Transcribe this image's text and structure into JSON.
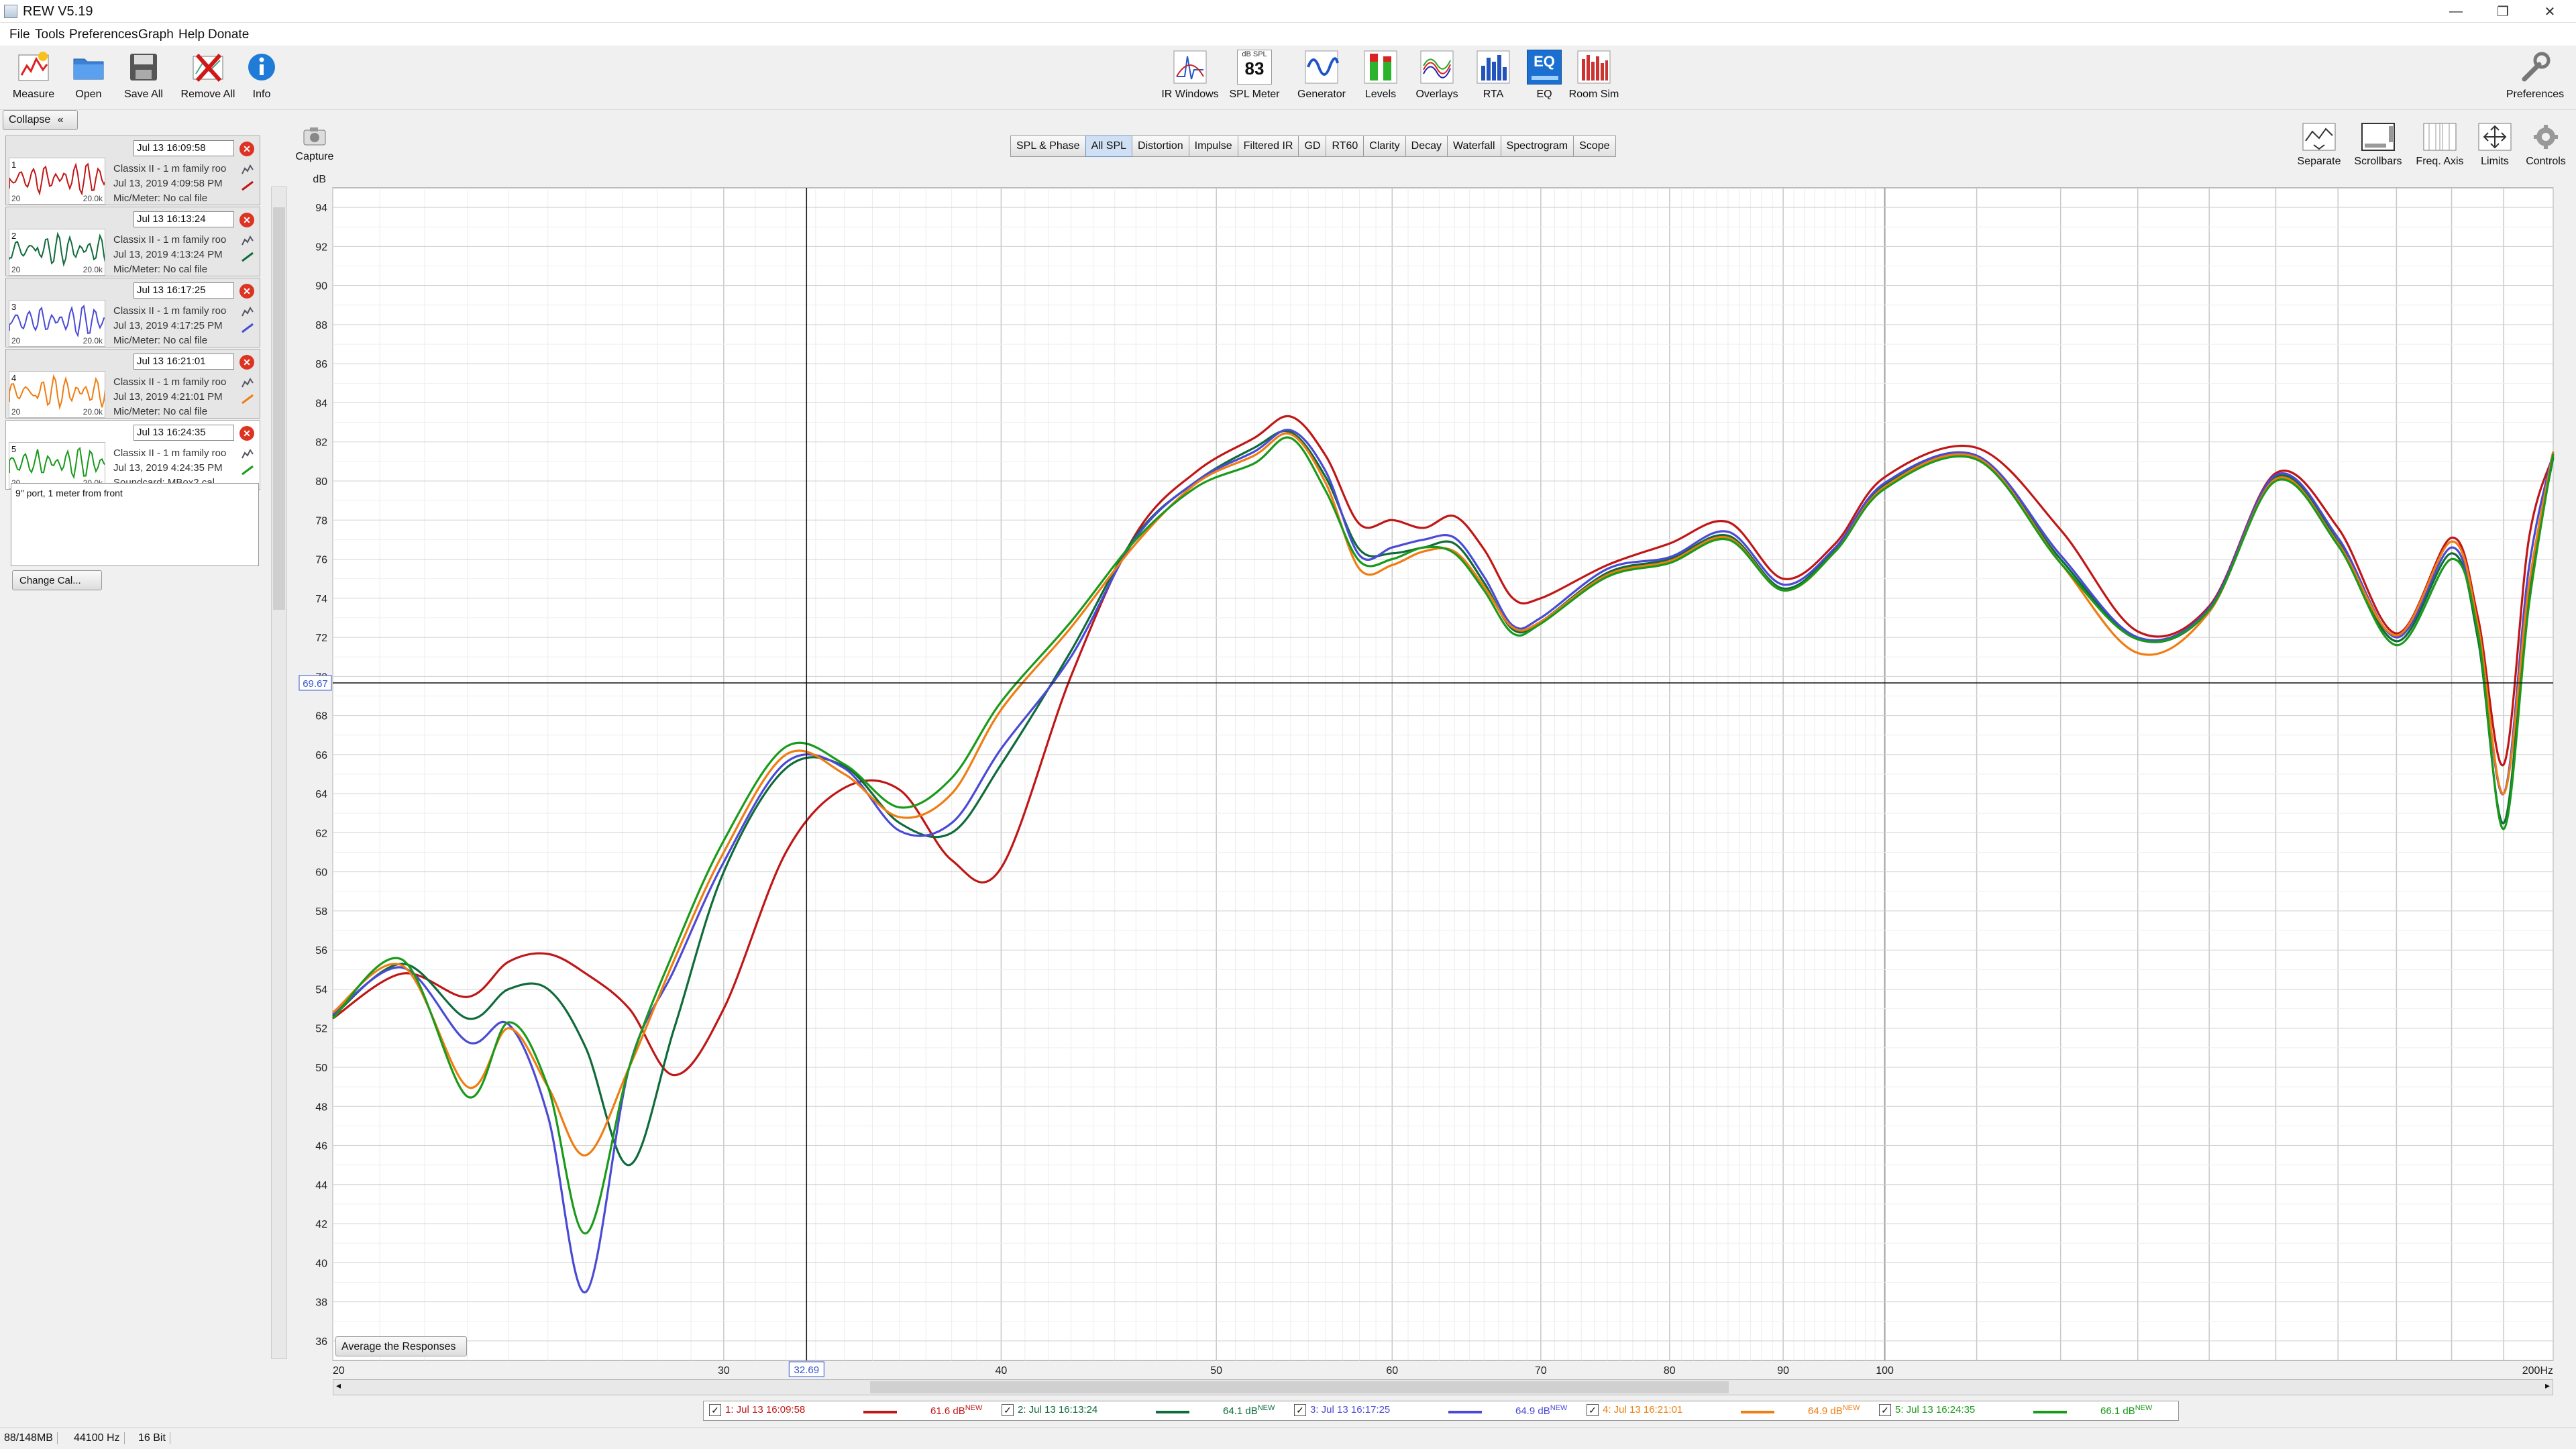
{
  "window": {
    "title": "REW V5.19",
    "controls": [
      "—",
      "❐",
      "✕"
    ]
  },
  "menu": [
    "File",
    "Tools",
    "Preferences",
    "Graph",
    "Help",
    "Donate"
  ],
  "toolbar_left": [
    "Measure",
    "Open",
    "Save All",
    "Remove All",
    "Info"
  ],
  "toolbar_center": [
    "IR Windows",
    "SPL Meter",
    "Generator",
    "Levels",
    "Overlays",
    "RTA",
    "EQ",
    "Room Sim"
  ],
  "spl_meter_value": "83",
  "spl_meter_unit": "dB SPL",
  "eq_icon_text": "EQ",
  "toolbar_right": "Preferences",
  "left_panel": {
    "collapse_label": "Collapse",
    "measurements": [
      {
        "num": "1",
        "name": "Jul 13 16:09:58",
        "desc": "Classix II - 1 m family roo",
        "date": "Jul 13, 2019 4:09:58 PM",
        "cal": "Mic/Meter: No cal file",
        "color": "#c01616",
        "selected": false
      },
      {
        "num": "2",
        "name": "Jul 13 16:13:24",
        "desc": "Classix II - 1 m family roo",
        "date": "Jul 13, 2019 4:13:24 PM",
        "cal": "Mic/Meter: No cal file",
        "color": "#0f6b3a",
        "selected": false
      },
      {
        "num": "3",
        "name": "Jul 13 16:17:25",
        "desc": "Classix II - 1 m family roo",
        "date": "Jul 13, 2019 4:17:25 PM",
        "cal": "Mic/Meter: No cal file",
        "color": "#4a4ad6",
        "selected": false
      },
      {
        "num": "4",
        "name": "Jul 13 16:21:01",
        "desc": "Classix II - 1 m family roo",
        "date": "Jul 13, 2019 4:21:01 PM",
        "cal": "Mic/Meter: No cal file",
        "color": "#ef7d12",
        "selected": false
      },
      {
        "num": "5",
        "name": "Jul 13 16:24:35",
        "desc": "Classix II - 1 m family roo",
        "date": "Jul 13, 2019 4:24:35 PM",
        "cal": "Soundcard: MBox2.cal",
        "color": "#1a9a1a",
        "selected": true
      }
    ],
    "thumb_low": "20",
    "thumb_high": "20.0k",
    "notes": "9\" port, 1 meter from front",
    "change_cal_label": "Change Cal..."
  },
  "capture_label": "Capture",
  "tabs": [
    "SPL & Phase",
    "All SPL",
    "Distortion",
    "Impulse",
    "Filtered IR",
    "GD",
    "RT60",
    "Clarity",
    "Decay",
    "Waterfall",
    "Spectrogram",
    "Scope"
  ],
  "active_tab": "All SPL",
  "graph_tools": [
    "Separate",
    "Scrollbars",
    "Freq. Axis",
    "Limits",
    "Controls"
  ],
  "average_button": "Average the Responses",
  "legend": [
    {
      "label": "1: Jul 13 16:09:58",
      "db": "61.6 dB",
      "color": "#c01616"
    },
    {
      "label": "2: Jul 13 16:13:24",
      "db": "64.1 dB",
      "color": "#0f6b3a"
    },
    {
      "label": "3: Jul 13 16:17:25",
      "db": "64.9 dB",
      "color": "#4a4ad6"
    },
    {
      "label": "4: Jul 13 16:21:01",
      "db": "64.9 dB",
      "color": "#ef7d12"
    },
    {
      "label": "5: Jul 13 16:24:35",
      "db": "66.1 dB",
      "color": "#1a9a1a"
    }
  ],
  "legend_new_tag": "NEW",
  "legend_check": "✓",
  "status": [
    "88/148MB",
    "44100 Hz",
    "16 Bit"
  ],
  "chart_data": {
    "type": "line",
    "title": "",
    "xlabel": "",
    "ylabel": "dB",
    "x_scale": "log",
    "xlim": [
      20,
      200
    ],
    "ylim": [
      35,
      95
    ],
    "x_tick_labels": [
      "20",
      "30",
      "40",
      "50",
      "60",
      "70",
      "80",
      "90",
      "100",
      "200Hz"
    ],
    "x_ticks": [
      20,
      30,
      40,
      50,
      60,
      70,
      80,
      90,
      100,
      200
    ],
    "y_ticks": [
      36,
      38,
      40,
      42,
      44,
      46,
      48,
      50,
      52,
      54,
      56,
      58,
      60,
      62,
      64,
      66,
      68,
      70,
      72,
      74,
      76,
      78,
      80,
      82,
      84,
      86,
      88,
      90,
      92,
      94
    ],
    "cursor": {
      "x": 32.69,
      "y": 69.67,
      "x_label": "32.69",
      "y_label": "69.67"
    },
    "grid": true,
    "series": [
      {
        "name": "1: Jul 13 16:09:58",
        "color": "#c01616",
        "x": [
          20,
          21.5,
          23,
          24,
          25,
          26,
          27.2,
          28.5,
          30,
          32,
          34,
          36,
          38,
          40,
          43,
          46,
          49,
          52,
          54,
          56,
          58,
          60,
          62,
          64,
          66,
          68,
          70,
          75,
          80,
          85,
          90,
          95,
          100,
          110,
          120,
          130,
          140,
          150,
          160,
          170,
          180,
          185,
          190,
          195,
          200
        ],
        "y": [
          52.5,
          54.8,
          53.6,
          55.4,
          55.8,
          54.8,
          53,
          49.6,
          53,
          61,
          64.3,
          64.2,
          60.6,
          60.2,
          70,
          77.3,
          80.5,
          82.2,
          83.3,
          81.3,
          77.8,
          78,
          77.6,
          78.2,
          76.5,
          74,
          74,
          75.7,
          76.8,
          77.9,
          75,
          76.8,
          80.2,
          81.7,
          77.5,
          72.3,
          73.6,
          80.4,
          77.6,
          72.2,
          77.1,
          73,
          65.5,
          77,
          81.3
        ]
      },
      {
        "name": "2: Jul 13 16:13:24",
        "color": "#0f6b3a",
        "x": [
          20,
          21.5,
          23,
          24,
          25,
          26,
          27.2,
          28.5,
          30,
          32,
          34,
          36,
          38,
          40,
          43,
          46,
          49,
          52,
          54,
          56,
          58,
          60,
          62,
          64,
          66,
          68,
          70,
          75,
          80,
          85,
          90,
          95,
          100,
          110,
          120,
          130,
          140,
          150,
          160,
          170,
          180,
          185,
          190,
          195,
          200
        ],
        "y": [
          52.6,
          55.3,
          52.5,
          54,
          54,
          51,
          45,
          52,
          60,
          65.3,
          65.4,
          62.5,
          62,
          65.5,
          71.3,
          77.2,
          80,
          81.7,
          82.5,
          80.2,
          76.5,
          76.3,
          76.6,
          76.8,
          74.8,
          72.4,
          72.8,
          75.3,
          76,
          77.2,
          74.5,
          76.5,
          79.8,
          81.2,
          76,
          71.9,
          73.4,
          80.2,
          76.9,
          71.8,
          76.3,
          71.9,
          62.5,
          74.2,
          81.2
        ]
      },
      {
        "name": "3: Jul 13 16:17:25",
        "color": "#4a4ad6",
        "x": [
          20,
          21.5,
          23,
          24,
          25,
          26,
          27.2,
          28.5,
          30,
          32,
          34,
          36,
          38,
          40,
          43,
          46,
          49,
          52,
          54,
          56,
          58,
          60,
          62,
          64,
          66,
          68,
          70,
          75,
          80,
          85,
          90,
          95,
          100,
          110,
          120,
          130,
          140,
          150,
          160,
          170,
          180,
          185,
          190,
          195,
          200
        ],
        "y": [
          52.7,
          55.1,
          51.3,
          52.2,
          47.5,
          38.5,
          50,
          55,
          60.5,
          65.6,
          65.3,
          62.1,
          62.5,
          66.3,
          71,
          77.1,
          80,
          81.5,
          82.6,
          80.5,
          76.2,
          76.6,
          77,
          77.1,
          75.1,
          72.6,
          73,
          75.5,
          76.1,
          77.4,
          74.7,
          76.6,
          79.9,
          81.3,
          76.2,
          72,
          73.5,
          80.3,
          77.1,
          72,
          76.6,
          72.3,
          64,
          75.5,
          81.5
        ]
      },
      {
        "name": "4: Jul 13 16:21:01",
        "color": "#ef7d12",
        "x": [
          20,
          21.5,
          23,
          24,
          25,
          26,
          27.2,
          28.5,
          30,
          32,
          34,
          36,
          38,
          40,
          43,
          46,
          49,
          52,
          54,
          56,
          58,
          60,
          62,
          64,
          66,
          68,
          70,
          75,
          80,
          85,
          90,
          95,
          100,
          110,
          120,
          130,
          140,
          150,
          160,
          170,
          180,
          185,
          190,
          195,
          200
        ],
        "y": [
          52.8,
          55.2,
          49,
          52,
          49,
          45.5,
          50,
          55.5,
          61,
          66,
          65,
          62.8,
          64,
          68.3,
          72.5,
          76.8,
          79.9,
          81.3,
          82.4,
          79.9,
          75.5,
          75.7,
          76.4,
          76.4,
          74.6,
          72.5,
          72.8,
          75.2,
          75.9,
          77.1,
          74.4,
          76.4,
          79.7,
          81.2,
          75.8,
          71.2,
          73.3,
          80.1,
          76.8,
          72.1,
          76.9,
          72.6,
          64,
          74.6,
          81.5
        ]
      },
      {
        "name": "5: Jul 13 16:24:35",
        "color": "#1a9a1a",
        "x": [
          20,
          21.5,
          23,
          24,
          25,
          26,
          27.2,
          28.5,
          30,
          32,
          34,
          36,
          38,
          40,
          43,
          46,
          49,
          52,
          54,
          56,
          58,
          60,
          62,
          64,
          66,
          68,
          70,
          75,
          80,
          85,
          90,
          95,
          100,
          110,
          120,
          130,
          140,
          150,
          160,
          170,
          180,
          185,
          190,
          195,
          200
        ],
        "y": [
          52.5,
          55.5,
          48.5,
          52.3,
          49,
          41.5,
          50,
          56,
          61.6,
          66.4,
          65.5,
          63.3,
          64.8,
          68.7,
          72.8,
          77,
          79.7,
          80.9,
          82.2,
          79.5,
          75.9,
          76,
          76.6,
          76.3,
          74.4,
          72.2,
          72.7,
          75.1,
          75.8,
          77.0,
          74.4,
          76.4,
          79.6,
          81.1,
          75.8,
          71.9,
          73.4,
          80.0,
          76.7,
          71.6,
          76.0,
          72.2,
          62.2,
          73.6,
          81.4
        ]
      }
    ]
  }
}
